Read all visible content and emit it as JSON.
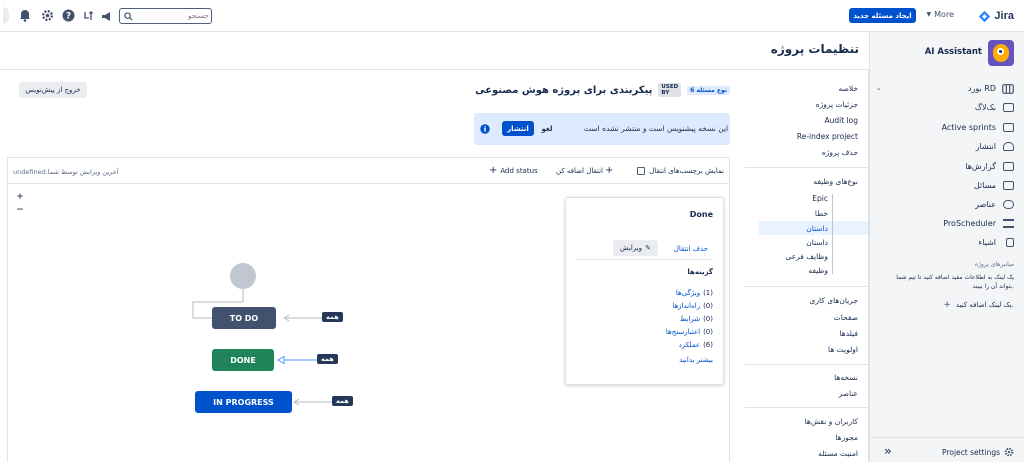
{
  "topbar": {
    "brand": "Jira",
    "more_label": "More",
    "create_label": "ایجاد مسئله جدید",
    "search_placeholder": "جستجو",
    "accent": "#0052cc"
  },
  "sidebar": {
    "project_name": "AI Assistant",
    "board_label": "بورد RD",
    "items": [
      {
        "label": "بک‌لاگ",
        "icon": "backlog-icon"
      },
      {
        "label": "Active sprints",
        "icon": "sprints-icon"
      },
      {
        "label": "انتشار",
        "icon": "release-icon"
      },
      {
        "label": "گزارش‌ها",
        "icon": "reports-icon"
      },
      {
        "label": "مسائل",
        "icon": "issues-icon"
      },
      {
        "label": "عناصر",
        "icon": "components-icon"
      },
      {
        "label": "ProScheduler",
        "icon": "scheduler-icon"
      },
      {
        "label": "اشیاء",
        "icon": "objects-icon"
      }
    ],
    "shortcuts_title": "میانبرهای پروژه",
    "shortcuts_desc_1": "یک لینک به اطلاعات مفید اضافه کنید تا تیم شما",
    "shortcuts_desc_2": "بتواند آن را ببیند.",
    "add_link_label": "یک لینک اضافه کنید.",
    "footer_settings": "Project settings",
    "collapse_symbol": "»"
  },
  "page": {
    "title": "تنظیمات پروژه"
  },
  "settings_nav": {
    "group1": [
      "خلاصه",
      "جزئیات پروژه",
      "Audit log",
      "Re-index project",
      "حذف پروژه"
    ],
    "group2_title": "نوع‌های وظیفه",
    "group2": [
      "Epic",
      "خطا",
      "داستان",
      "داستان",
      "وظایف فرعی",
      "وظیفه"
    ],
    "group2_selected_index": 2,
    "group3": [
      "جریان‌های کاری",
      "صفحات",
      "فیلدها",
      "اولویت ها"
    ],
    "group4": [
      "نسخه‌ها",
      "عناصر"
    ],
    "group5": [
      "کاربران و نقش‌ها",
      "مجوزها",
      "امنیت مسئله"
    ]
  },
  "workflow": {
    "title": "پیکربندی برای پروژه هوش مصنوعی",
    "used_by": "USED BY",
    "issue_types_badge": "6 نوع مسئله",
    "exit_draft_label": "خروج از پیش‌نویس",
    "draft_notice": "این نسخه پیشنویس است و منتشر نشده است",
    "publish_label": "انتشار",
    "discard_label": "لغو",
    "show_transition_labels": "نمایش برچسب‌های انتقال",
    "add_transition": "انتقال اضافه کن",
    "add_status": "Add status",
    "last_edited": "آخرین ویرایش توسط شما.undefined",
    "zoom_in": "+",
    "zoom_out": "−",
    "statuses": [
      {
        "label": "TO DO",
        "color": "#42526e"
      },
      {
        "label": "DONE",
        "color": "#1f845a"
      },
      {
        "label": "IN PROGRESS",
        "color": "#0052cc"
      }
    ],
    "all_tag": "همه"
  },
  "details": {
    "status_name": "Done",
    "delete_transition": "حذف انتقال",
    "edit_label": "ویرایش",
    "options_title": "گزینه‌ها",
    "options": [
      {
        "count": "(1)",
        "label": "ویژگی‌ها"
      },
      {
        "count": "(0)",
        "label": "راه‌اندازها"
      },
      {
        "count": "(0)",
        "label": "شرایط"
      },
      {
        "count": "(0)",
        "label": "اعتبارسنج‌ها"
      },
      {
        "count": "(6)",
        "label": "عملکرد"
      }
    ],
    "learn_more": "بیشتر بدانید"
  }
}
